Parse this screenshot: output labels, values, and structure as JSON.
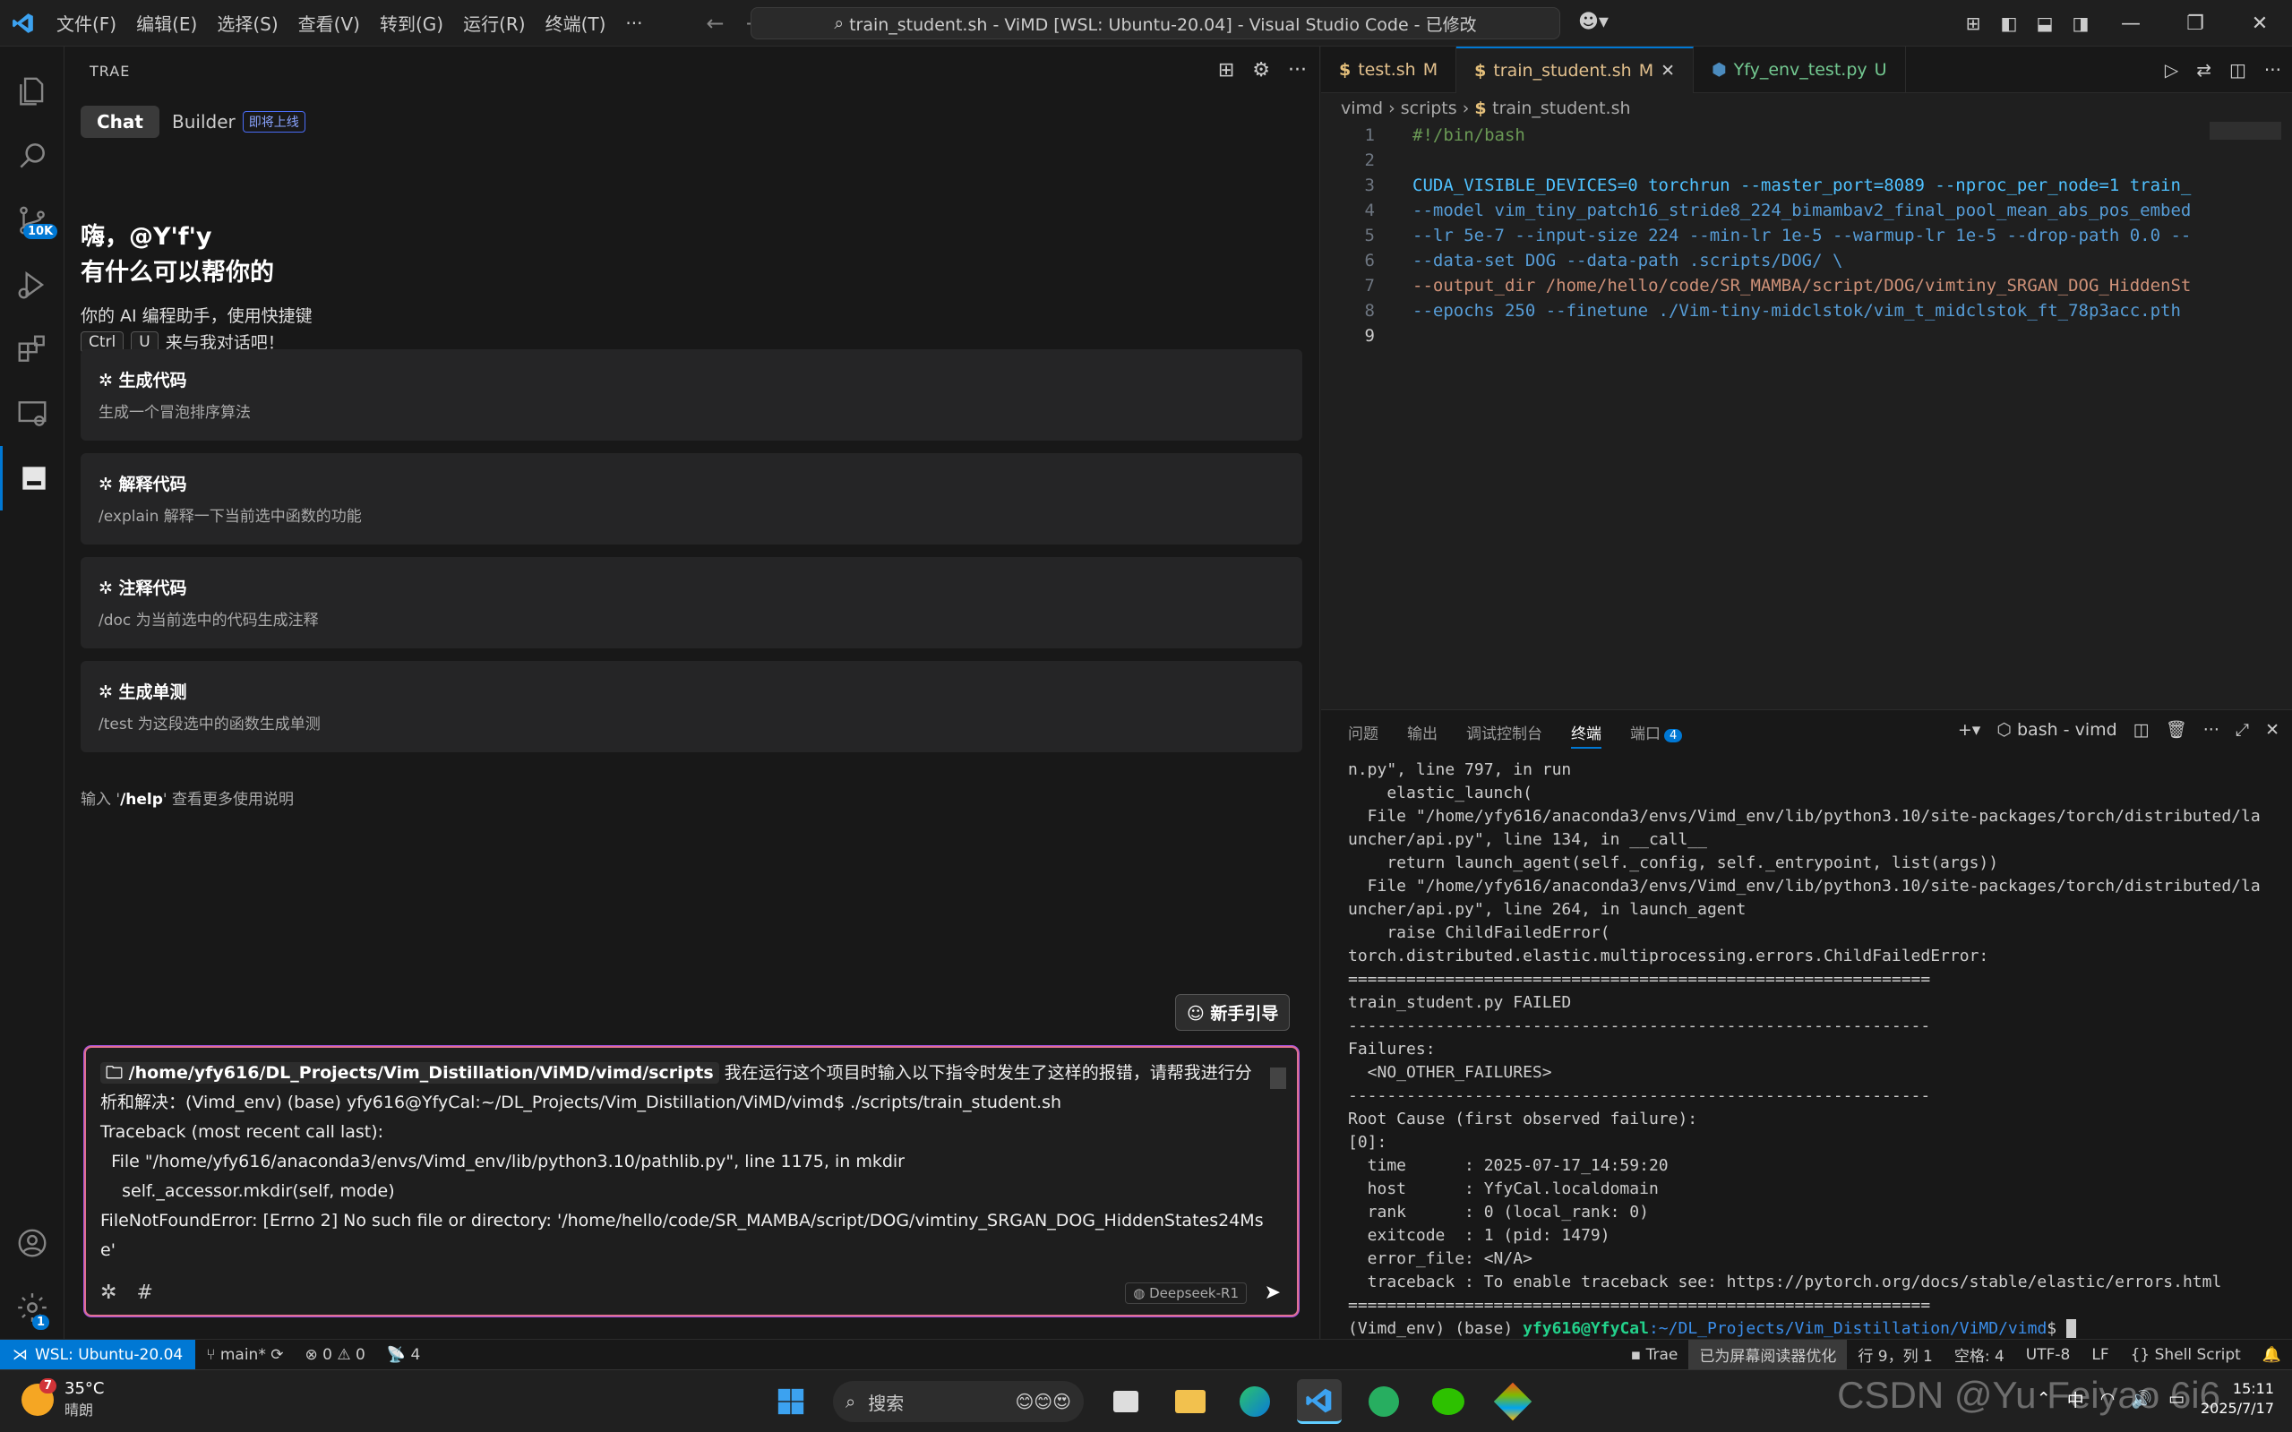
{
  "titlebar": {
    "menus": [
      "文件(F)",
      "编辑(E)",
      "选择(S)",
      "查看(V)",
      "转到(G)",
      "运行(R)",
      "终端(T)",
      "···"
    ],
    "command_center": "train_student.sh - ViMD [WSL: Ubuntu-20.04] - Visual Studio Code - 已修改"
  },
  "activity": {
    "badge_source_control": "10K",
    "badge_settings": "1"
  },
  "trae": {
    "panel_title": "TRAE",
    "tab_chat": "Chat",
    "tab_builder": "Builder",
    "builder_badge": "即将上线",
    "greeting_line1": "嗨，@Y'f'y",
    "greeting_line2": "有什么可以帮你的",
    "intro_line1": "你的 AI 编程助手，使用快捷键",
    "intro_key1": "Ctrl",
    "intro_key2": "U",
    "intro_line2": "来与我对话吧！",
    "cards": [
      {
        "title": "生成代码",
        "desc": "生成一个冒泡排序算法"
      },
      {
        "title": "解释代码",
        "desc": "/explain 解释一下当前选中函数的功能"
      },
      {
        "title": "注释代码",
        "desc": "/doc 为当前选中的代码生成注释"
      },
      {
        "title": "生成单测",
        "desc": "/test 为这段选中的函数生成单测"
      }
    ],
    "help_prefix": "输入 '",
    "help_cmd": "/help",
    "help_suffix": "' 查看更多使用说明",
    "guide_button": "新手引导",
    "input": {
      "path_chip": "/home/yfy616/DL_Projects/Vim_Distillation/ViMD/vimd/scripts",
      "line1": "我在运行这个项目时输入以下指令时发生了这样的报错，请帮我进行分析和解决：(Vimd_env) (base) yfy616@YfyCal:~/DL_Projects/Vim_Distillation/ViMD/vimd$ ./scripts/train_student.sh",
      "line2": "Traceback (most recent call last):",
      "line3": "  File \"/home/yfy616/anaconda3/envs/Vimd_env/lib/python3.10/pathlib.py\", line 1175, in mkdir",
      "line4": "    self._accessor.mkdir(self, mode)",
      "line5": "FileNotFoundError: [Errno 2] No such file or directory: '/home/hello/code/SR_MAMBA/script/DOG/vimtiny_SRGAN_DOG_HiddenStates24Mse'",
      "model": "Deepseek-R1"
    }
  },
  "editor": {
    "tabs": [
      {
        "name": "test.sh",
        "status": "M"
      },
      {
        "name": "train_student.sh",
        "status": "M"
      },
      {
        "name": "Yfy_env_test.py",
        "status": "U"
      }
    ],
    "breadcrumb": [
      "vimd",
      "scripts",
      "train_student.sh"
    ],
    "lines": [
      "#!/bin/bash",
      "",
      "CUDA_VISIBLE_DEVICES=0 torchrun --master_port=8089 --nproc_per_node=1 train_",
      "--model vim_tiny_patch16_stride8_224_bimambav2_final_pool_mean_abs_pos_embed",
      "--lr 5e-7 --input-size 224 --min-lr 1e-5 --warmup-lr 1e-5 --drop-path 0.0 --",
      "--data-set DOG --data-path  .scripts/DOG/ \\",
      "--output_dir /home/hello/code/SR_MAMBA/script/DOG/vimtiny_SRGAN_DOG_HiddenSt",
      "--epochs 250 --finetune ./Vim-tiny-midclstok/vim_t_midclstok_ft_78p3acc.pth",
      ""
    ]
  },
  "panel": {
    "tabs": [
      "问题",
      "输出",
      "调试控制台",
      "终端",
      "端口"
    ],
    "ports_count": "4",
    "terminal_name": "bash - vimd",
    "terminal_lines": [
      "n.py\", line 797, in run",
      "    elastic_launch(",
      "  File \"/home/yfy616/anaconda3/envs/Vimd_env/lib/python3.10/site-packages/torch/distributed/la",
      "uncher/api.py\", line 134, in __call__",
      "    return launch_agent(self._config, self._entrypoint, list(args))",
      "  File \"/home/yfy616/anaconda3/envs/Vimd_env/lib/python3.10/site-packages/torch/distributed/la",
      "uncher/api.py\", line 264, in launch_agent",
      "    raise ChildFailedError(",
      "torch.distributed.elastic.multiprocessing.errors.ChildFailedError:",
      "============================================================",
      "train_student.py FAILED",
      "------------------------------------------------------------",
      "Failures:",
      "  <NO_OTHER_FAILURES>",
      "------------------------------------------------------------",
      "Root Cause (first observed failure):",
      "[0]:",
      "  time      : 2025-07-17_14:59:20",
      "  host      : YfyCal.localdomain",
      "  rank      : 0 (local_rank: 0)",
      "  exitcode  : 1 (pid: 1479)",
      "  error_file: <N/A>",
      "  traceback : To enable traceback see: https://pytorch.org/docs/stable/elastic/errors.html",
      "============================================================"
    ],
    "prompt_env": "(Vimd_env) (base) ",
    "prompt_user": "yfy616@YfyCal",
    "prompt_path": ":~/DL_Projects/Vim_Distillation/ViMD/vimd",
    "prompt_end": "$ "
  },
  "statusbar": {
    "remote": "WSL: Ubuntu-20.04",
    "branch": "main*",
    "errors": "0",
    "warnings": "0",
    "ports": "4",
    "trae": "Trae",
    "screen_reader": "已为屏幕阅读器优化",
    "position": "行 9，列 1",
    "spaces": "空格: 4",
    "encoding": "UTF-8",
    "eol": "LF",
    "language": "Shell Script"
  },
  "taskbar": {
    "weather_temp": "35°C",
    "weather_cond": "晴朗",
    "weather_badge": "7",
    "search_placeholder": "搜索",
    "ime": "中",
    "time": "15:11",
    "date": "2025/7/17",
    "watermark": "CSDN @Yu Feiyao 6i6"
  },
  "colors": {
    "accent": "#0078d4",
    "input_border": "#e07090"
  }
}
